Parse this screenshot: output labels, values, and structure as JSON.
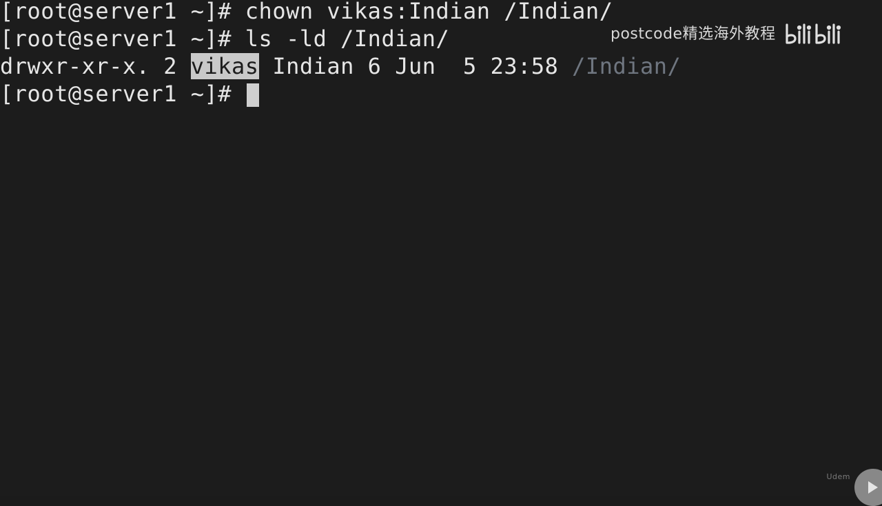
{
  "terminal": {
    "lines": [
      {
        "prompt": "[root@server1 ~]#",
        "command": " chown vikas:Indian /Indian/"
      },
      {
        "prompt": "[root@server1 ~]#",
        "command": " ls -ld /Indian/"
      },
      {
        "perms_links": "drwxr-xr-x. 2 ",
        "user": "vikas",
        "group_size_date": " Indian 6 Jun  5 23:58 ",
        "path": "/Indian/"
      },
      {
        "prompt": "[root@server1 ~]#",
        "command": " "
      }
    ]
  },
  "watermark": {
    "text": "postcode精选海外教程",
    "logo_name": "bilibili-logo"
  },
  "corner": {
    "text": "Udem",
    "icon": "play-icon"
  },
  "colors": {
    "background": "#1c1c1c",
    "foreground": "#e6e6e6",
    "highlight": "#c9c9c9",
    "path": "#6f7680"
  }
}
